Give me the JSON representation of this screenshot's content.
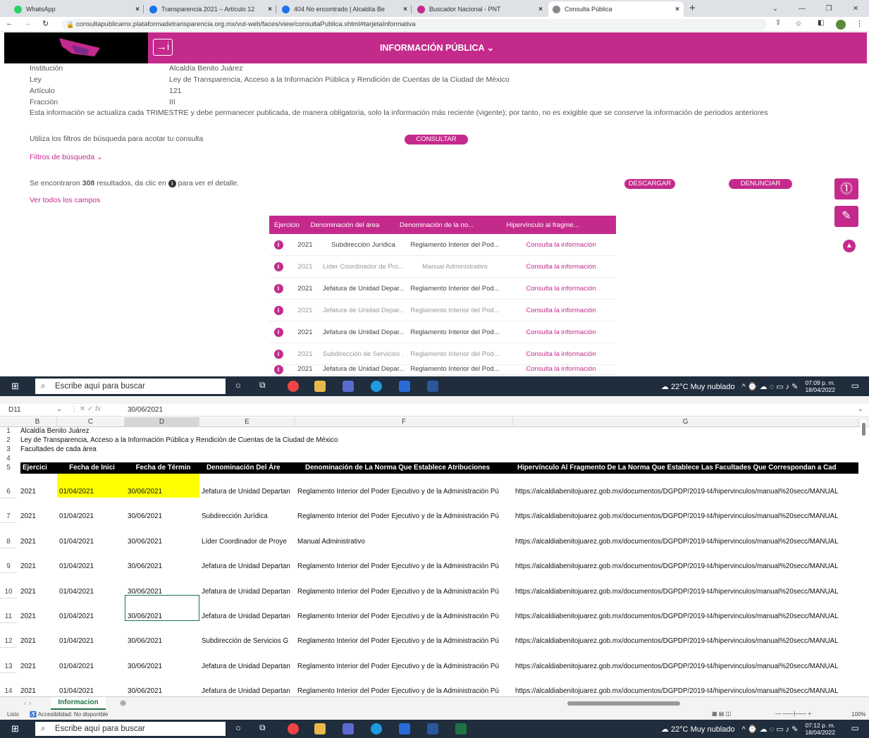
{
  "browser": {
    "tabs": [
      {
        "label": "WhatsApp",
        "color": "#25d366"
      },
      {
        "label": "Transparencia 2021 – Artículo 12",
        "color": "#1a73e8"
      },
      {
        "label": "404 No encontrado | Alcaldía Be",
        "color": "#1a73e8"
      },
      {
        "label": "Buscador Nacional - PNT",
        "color": "#c42a8c"
      },
      {
        "label": "Consulta Pública",
        "color": "#888888"
      }
    ],
    "url": "consultapublicamx.plataformadetransparencia.org.mx/vut-web/faces/view/consultaPublica.xhtml#tarjetaInformativa"
  },
  "site": {
    "title": "INFORMACIÓN PÚBLICA",
    "fields": [
      {
        "label": "Institución",
        "value": "Alcaldía Benito Juárez"
      },
      {
        "label": "Ley",
        "value": "Ley de Transparencia, Acceso a la Información Pública y Rendición de Cuentas de la Ciudad de México"
      },
      {
        "label": "Artículo",
        "value": "121"
      },
      {
        "label": "Fracción",
        "value": "III"
      }
    ],
    "notice": "Esta información se actualiza cada TRIMESTRE y debe permanecer publicada, de manera obligatoria, solo la información más reciente (vigente); por tanto, no es exigible que se conserve la información de periodos anteriores",
    "filter_hint": "Utiliza los filtros de búsqueda para acotar tu consulta",
    "consult_button": "CONSULTAR",
    "filters_link": "Filtros de búsqueda",
    "results_prefix": "Se encontraron",
    "results_count": "308",
    "results_mid": "resultados, da clic en",
    "results_suffix": "para ver el detalle.",
    "download_button": "DESCARGAR",
    "report_button": "DENUNCIAR",
    "all_fields_link": "Ver todos los campos",
    "table_headers": [
      "Ejercicio",
      "Denominación del área",
      "Denominación de la no...",
      "Hipervínculo al fragme..."
    ],
    "rows": [
      {
        "year": "2021",
        "area": "Subdirección Jurídica",
        "norma": "Reglamento Interior del Pod...",
        "link": "Consulta la información"
      },
      {
        "year": "2021",
        "area": "Líder Coordinador de Pro...",
        "norma": "Manual Administrativo",
        "link": "Consulta la información"
      },
      {
        "year": "2021",
        "area": "Jefatura de Unidad Depar...",
        "norma": "Reglamento Interior del Pod...",
        "link": "Consulta la información"
      },
      {
        "year": "2021",
        "area": "Jefatura de Unidad Depar...",
        "norma": "Reglamento Interior del Pod...",
        "link": "Consulta la información"
      },
      {
        "year": "2021",
        "area": "Jefatura de Unidad Depar...",
        "norma": "Reglamento Interior del Pod...",
        "link": "Consulta la información"
      },
      {
        "year": "2021",
        "area": "Subdirección de Servicios ...",
        "norma": "Reglamento Interior del Pod...",
        "link": "Consulta la información"
      },
      {
        "year": "2021",
        "area": "Jefatura de Unidad Depar...",
        "norma": "Reglamento Interior del Pod...",
        "link": "Consulta la información"
      }
    ]
  },
  "taskbar": {
    "search_placeholder": "Escribe aquí para buscar",
    "weather": "22°C Muy nublado",
    "time_top": "07:09 p. m.",
    "date_top": "18/04/2022",
    "time_bottom": "07:12 p. m.",
    "date_bottom": "18/04/2022"
  },
  "excel": {
    "cell_ref": "D11",
    "formula": "30/06/2021",
    "columns": [
      "B",
      "C",
      "D",
      "E",
      "F",
      "G"
    ],
    "title_rows": [
      "Alcaldía Benito Juárez",
      "Ley de Transparencia, Acceso a la Información Pública y Rendición de Cuentas de la Ciudad de México",
      "Facultades de cada área"
    ],
    "headers": [
      "Ejercici",
      "Fecha de Inici",
      "Fecha de Términ",
      "Denominación Del Áre",
      "Denominación de La Norma Que Establece Atribuciones",
      "Hipervínculo Al Fragmento De La Norma Que Establece Las Facultades Que Correspondan a Cad"
    ],
    "rows": [
      {
        "n": "6",
        "year": "2021",
        "start": "01/04/2021",
        "end": "30/06/2021",
        "area": "Jefatura de Unidad Departan",
        "norma": "Reglamento Interior del Poder Ejecutivo y de la Administración Pú",
        "url": "https://alcaldiabenitojuarez.gob.mx/documentos/DGPDP/2019-t4/hipervinculos/manual%20secc/MANUAL"
      },
      {
        "n": "7",
        "year": "2021",
        "start": "01/04/2021",
        "end": "30/06/2021",
        "area": "Subdirección Jurídica",
        "norma": "Reglamento Interior del Poder Ejecutivo y de la Administración Pú",
        "url": "https://alcaldiabenitojuarez.gob.mx/documentos/DGPDP/2019-t4/hipervinculos/manual%20secc/MANUAL"
      },
      {
        "n": "8",
        "year": "2021",
        "start": "01/04/2021",
        "end": "30/06/2021",
        "area": "Líder Coordinador de Proye",
        "norma": "Manual Administrativo",
        "url": "https://alcaldiabenitojuarez.gob.mx/documentos/DGPDP/2019-t4/hipervinculos/manual%20secc/MANUAL"
      },
      {
        "n": "9",
        "year": "2021",
        "start": "01/04/2021",
        "end": "30/06/2021",
        "area": "Jefatura de Unidad Departan",
        "norma": "Reglamento Interior del Poder Ejecutivo y de la Administración Pú",
        "url": "https://alcaldiabenitojuarez.gob.mx/documentos/DGPDP/2019-t4/hipervinculos/manual%20secc/MANUAL"
      },
      {
        "n": "10",
        "year": "2021",
        "start": "01/04/2021",
        "end": "30/06/2021",
        "area": "Jefatura de Unidad Departan",
        "norma": "Reglamento Interior del Poder Ejecutivo y de la Administración Pú",
        "url": "https://alcaldiabenitojuarez.gob.mx/documentos/DGPDP/2019-t4/hipervinculos/manual%20secc/MANUAL"
      },
      {
        "n": "11",
        "year": "2021",
        "start": "01/04/2021",
        "end": "30/06/2021",
        "area": "Jefatura de Unidad Departan",
        "norma": "Reglamento Interior del Poder Ejecutivo y de la Administración Pú",
        "url": "https://alcaldiabenitojuarez.gob.mx/documentos/DGPDP/2019-t4/hipervinculos/manual%20secc/MANUAL"
      },
      {
        "n": "12",
        "year": "2021",
        "start": "01/04/2021",
        "end": "30/06/2021",
        "area": "Subdirección de Servicios G",
        "norma": "Reglamento Interior del Poder Ejecutivo y de la Administración Pú",
        "url": "https://alcaldiabenitojuarez.gob.mx/documentos/DGPDP/2019-t4/hipervinculos/manual%20secc/MANUAL"
      },
      {
        "n": "13",
        "year": "2021",
        "start": "01/04/2021",
        "end": "30/06/2021",
        "area": "Jefatura de Unidad Departan",
        "norma": "Reglamento Interior del Poder Ejecutivo y de la Administración Pú",
        "url": "https://alcaldiabenitojuarez.gob.mx/documentos/DGPDP/2019-t4/hipervinculos/manual%20secc/MANUAL"
      },
      {
        "n": "14",
        "year": "2021",
        "start": "01/04/2021",
        "end": "30/06/2021",
        "area": "Jefatura de Unidad Departan",
        "norma": "Reglamento Interior del Poder Ejecutivo y de la Administración Pú",
        "url": "https://alcaldiabenitojuarez.gob.mx/documentos/DGPDP/2019-t4/hipervinculos/manual%20secc/MANUAL"
      }
    ],
    "sheet_tab": "Informacion",
    "status_ready": "Listo",
    "status_access": "Accesibilidad: No disponible",
    "zoom": "100%"
  }
}
